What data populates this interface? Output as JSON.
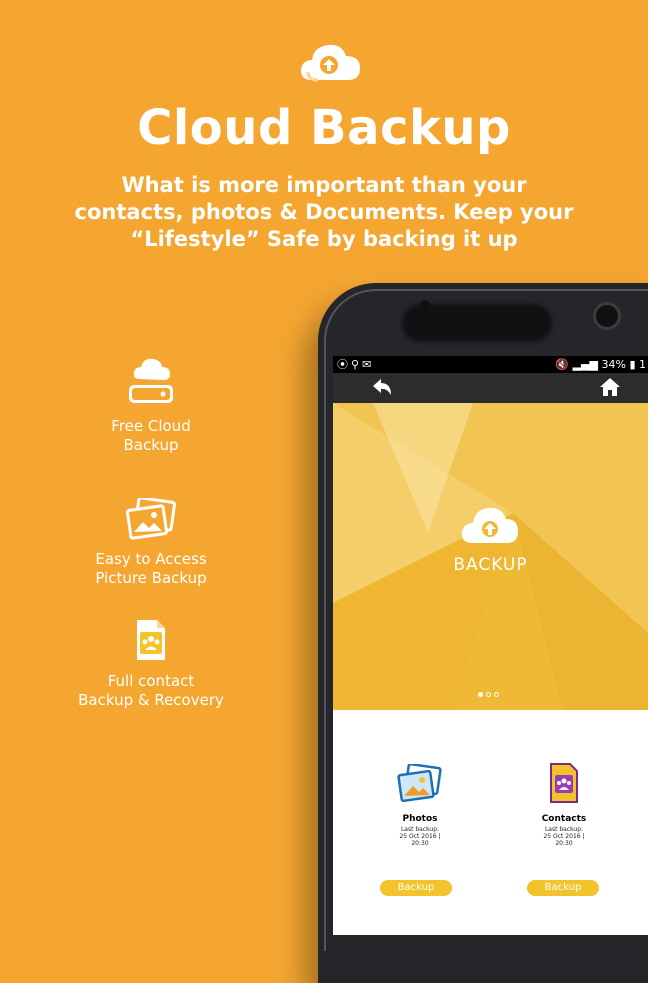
{
  "header": {
    "title": "Cloud Backup",
    "subtitle_lines": [
      "What is more important than your",
      "contacts, photos & Documents. Keep your",
      "“Lifestyle” Safe by  backing it up"
    ]
  },
  "features": [
    {
      "lines": [
        "Free Cloud",
        "Backup"
      ],
      "icon": "cloud-drive-icon"
    },
    {
      "lines": [
        "Easy to Access",
        "Picture Backup"
      ],
      "icon": "pictures-icon"
    },
    {
      "lines": [
        "Full contact",
        "Backup & Recovery"
      ],
      "icon": "contacts-file-icon"
    }
  ],
  "phone": {
    "status": {
      "battery": "34%",
      "trailing": "1"
    },
    "hero_label": "BACKUP",
    "carousel": {
      "count": 3,
      "active": 0
    },
    "cards": [
      {
        "title": "Photos",
        "meta_lines": [
          "Last backup:",
          "25 Oct 2016 |",
          "20:30"
        ],
        "button": "Backup",
        "icon": "photos-icon"
      },
      {
        "title": "Contacts",
        "meta_lines": [
          "Last backup:",
          "25 Oct 2016 |",
          "20:30"
        ],
        "button": "Backup",
        "icon": "contacts-icon"
      }
    ]
  },
  "colors": {
    "background": "#f5a631",
    "hero": "#efb935",
    "button": "#f3c32c",
    "appbar": "#2c2c2c"
  }
}
